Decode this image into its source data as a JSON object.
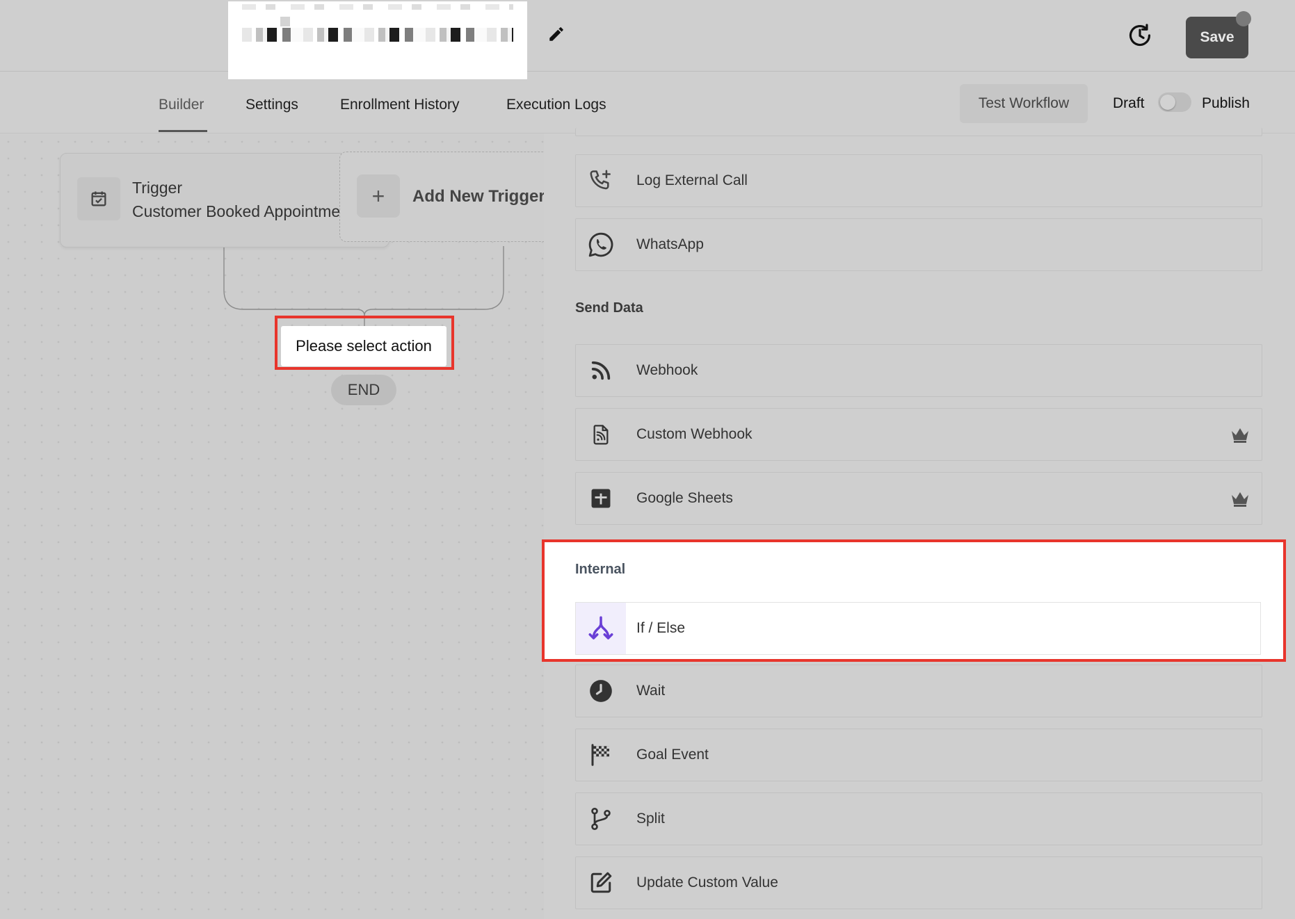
{
  "header": {
    "save_label": "Save"
  },
  "nav": {
    "tabs": [
      {
        "label": "Builder",
        "active": true
      },
      {
        "label": "Settings",
        "active": false
      },
      {
        "label": "Enrollment History",
        "active": false
      },
      {
        "label": "Execution Logs",
        "active": false
      }
    ],
    "test_workflow_label": "Test Workflow",
    "draft_label": "Draft",
    "publish_label": "Publish",
    "publish_toggle_on": false
  },
  "canvas": {
    "trigger_title": "Trigger",
    "trigger_subtitle": "Customer Booked Appointment",
    "add_trigger_label": "Add New Trigger",
    "action_placeholder": "Please select action",
    "end_label": "END"
  },
  "panel": {
    "communication_items": [
      {
        "label": "Log External Call",
        "icon": "phone-plus-icon",
        "premium": false
      },
      {
        "label": "WhatsApp",
        "icon": "whatsapp-icon",
        "premium": false
      }
    ],
    "send_data_title": "Send Data",
    "send_data_items": [
      {
        "label": "Webhook",
        "icon": "rss-icon",
        "premium": false
      },
      {
        "label": "Custom Webhook",
        "icon": "file-rss-icon",
        "premium": true
      },
      {
        "label": "Google Sheets",
        "icon": "sheets-icon",
        "premium": true
      }
    ],
    "internal_title": "Internal",
    "internal_highlight_item": {
      "label": "If / Else",
      "icon": "split-arrows-icon"
    },
    "internal_items": [
      {
        "label": "Wait",
        "icon": "clock-icon",
        "premium": false
      },
      {
        "label": "Goal Event",
        "icon": "checkered-flag-icon",
        "premium": false
      },
      {
        "label": "Split",
        "icon": "git-branch-icon",
        "premium": false
      },
      {
        "label": "Update Custom Value",
        "icon": "edit-square-icon",
        "premium": false
      }
    ]
  },
  "colors": {
    "highlight": "#e8352c",
    "ifelse_accent": "#6a3fd6"
  }
}
